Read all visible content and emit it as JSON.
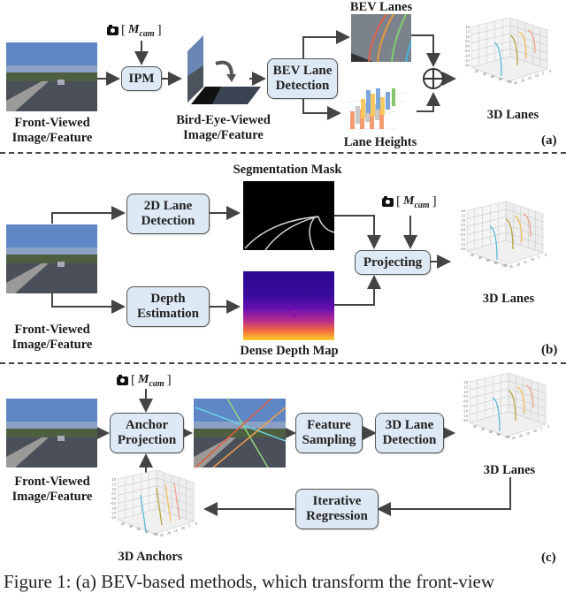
{
  "camera_label": {
    "prefix": "[",
    "symbol": "M",
    "subscript": "cam",
    "suffix": "]",
    "icon": "camera-icon"
  },
  "panel_a": {
    "tag": "(a)",
    "input_label": [
      "Front-Viewed",
      "Image/Feature"
    ],
    "ipm_box": "IPM",
    "bev_image_label": [
      "Bird-Eye-Viewed",
      "Image/Feature"
    ],
    "bev_detection_box": [
      "BEV Lane",
      "Detection"
    ],
    "bev_lanes_label": "BEV Lanes",
    "lane_heights_label": "Lane Heights",
    "sum_symbol": "⊕",
    "output_label": "3D Lanes"
  },
  "panel_b": {
    "tag": "(b)",
    "input_label": [
      "Front-Viewed",
      "Image/Feature"
    ],
    "lane2d_box": [
      "2D Lane",
      "Detection"
    ],
    "depth_box": [
      "Depth",
      "Estimation"
    ],
    "seg_mask_label": "Segmentation Mask",
    "depth_map_label": "Dense Depth Map",
    "projecting_box": "Projecting",
    "output_label": "3D Lanes"
  },
  "panel_c": {
    "tag": "(c)",
    "input_label": [
      "Front-Viewed",
      "Image/Feature"
    ],
    "anchor_box": [
      "Anchor",
      "Projection"
    ],
    "feature_box": [
      "Feature",
      "Sampling"
    ],
    "lane3d_box": [
      "3D Lane",
      "Detection"
    ],
    "iterative_box": [
      "Iterative",
      "Regression"
    ],
    "output_label": "3D Lanes",
    "anchors_label": "3D Anchors"
  },
  "plot3d": {
    "z_ticks": [
      "2.0",
      "1.5",
      "1.0",
      "0.5",
      "0.0",
      "−0.5",
      "−1.0",
      "−1.5",
      "−2.0"
    ],
    "x_ticks": [
      "20",
      "40",
      "60",
      "80",
      "100"
    ],
    "y_ticks": [
      "0",
      "5",
      "10",
      "15",
      "20",
      "25"
    ],
    "lane_colors": [
      "#5bb8d6",
      "#b9a640",
      "#f2c05a",
      "#f0a38e"
    ]
  },
  "caption": "Figure 1:  (a) BEV-based methods, which transform the front-view"
}
